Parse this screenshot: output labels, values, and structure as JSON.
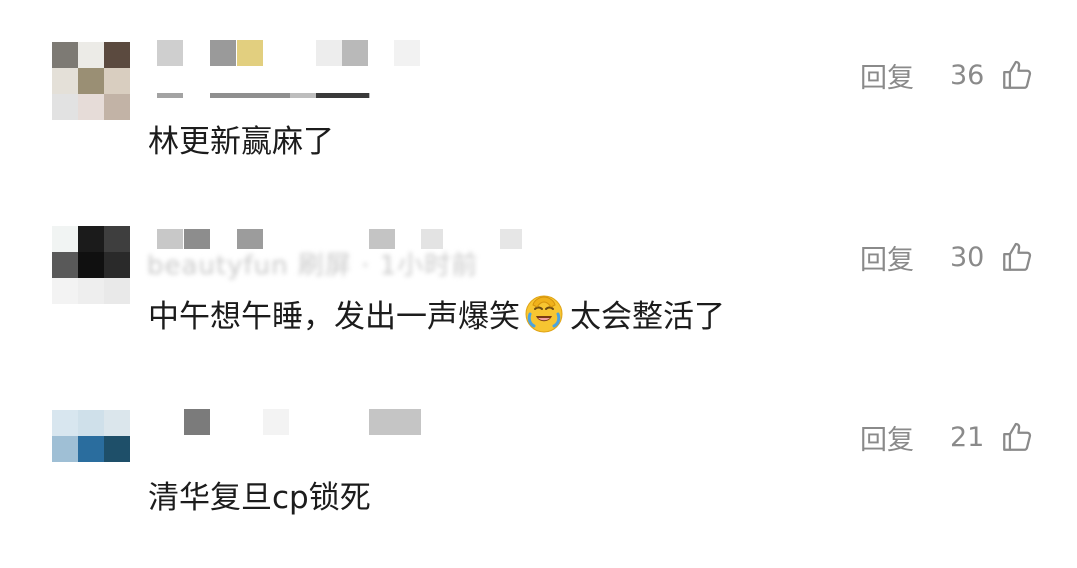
{
  "comments": [
    {
      "text": "林更新赢麻了",
      "reply_label": "回复",
      "likes": "36",
      "avatar_colors": [
        "#7d7a74",
        "#ecebe7",
        "#5b4a3f",
        "#e4e0d8",
        "#9a8f74",
        "#d9cec0",
        "#e2e2e2",
        "#e6dcd8",
        "#c2b3a6"
      ]
    },
    {
      "text_before": "中午想午睡，发出一声爆笑",
      "emoji": "facepalm-laughing-emoji",
      "text_after": "太会整活了",
      "reply_label": "回复",
      "likes": "30",
      "username_blur": "beautyfun  刷屏 · 1小时前",
      "avatar_colors": [
        "#f1f4f3",
        "#1b1b1b",
        "#3e3e3e",
        "#595959",
        "#101010",
        "#2a2a2a",
        "#f3f3f3",
        "#eeeeee",
        "#e9e9e9"
      ]
    },
    {
      "text": "清华复旦cp锁死",
      "reply_label": "回复",
      "likes": "21",
      "avatar_colors": [
        "#d8e6ef",
        "#cfe0ea",
        "#dbe6ec",
        "#9fbfd5",
        "#2a6d9e",
        "#1e4f69",
        "#ffffff",
        "#ffffff",
        "#ffffff"
      ]
    }
  ]
}
